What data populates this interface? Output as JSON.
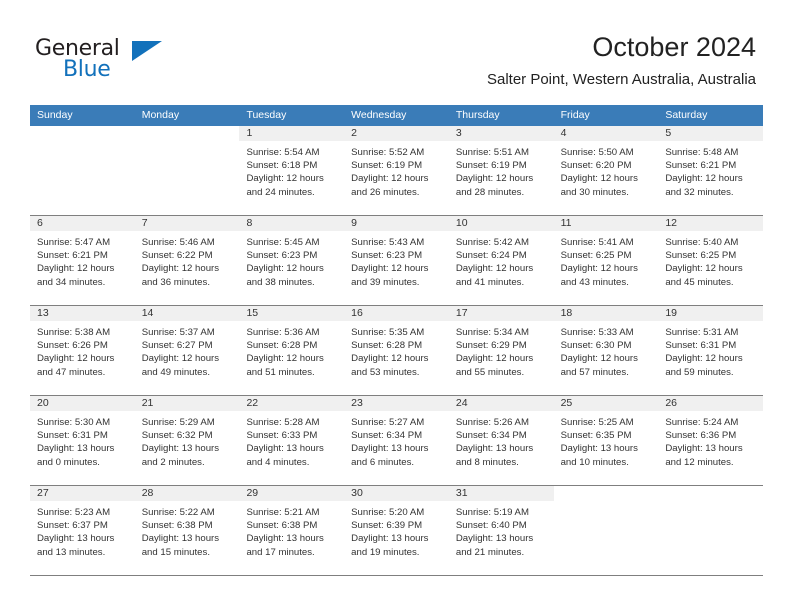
{
  "brand": {
    "name_part1": "General",
    "name_part2": "Blue",
    "accent_color": "#1271bb"
  },
  "header": {
    "title": "October 2024",
    "subtitle": "Salter Point, Western Australia, Australia"
  },
  "calendar": {
    "header_bg": "#3a7cb8",
    "daynum_band_bg": "#f0f0f0",
    "weekdays": [
      "Sunday",
      "Monday",
      "Tuesday",
      "Wednesday",
      "Thursday",
      "Friday",
      "Saturday"
    ],
    "labels": {
      "sunrise": "Sunrise:",
      "sunset": "Sunset:",
      "daylight": "Daylight:"
    },
    "weeks": [
      [
        {
          "day": "",
          "empty": true
        },
        {
          "day": "",
          "empty": true
        },
        {
          "day": "1",
          "sunrise": "Sunrise: 5:54 AM",
          "sunset": "Sunset: 6:18 PM",
          "daylight_1": "Daylight: 12 hours",
          "daylight_2": "and 24 minutes."
        },
        {
          "day": "2",
          "sunrise": "Sunrise: 5:52 AM",
          "sunset": "Sunset: 6:19 PM",
          "daylight_1": "Daylight: 12 hours",
          "daylight_2": "and 26 minutes."
        },
        {
          "day": "3",
          "sunrise": "Sunrise: 5:51 AM",
          "sunset": "Sunset: 6:19 PM",
          "daylight_1": "Daylight: 12 hours",
          "daylight_2": "and 28 minutes."
        },
        {
          "day": "4",
          "sunrise": "Sunrise: 5:50 AM",
          "sunset": "Sunset: 6:20 PM",
          "daylight_1": "Daylight: 12 hours",
          "daylight_2": "and 30 minutes."
        },
        {
          "day": "5",
          "sunrise": "Sunrise: 5:48 AM",
          "sunset": "Sunset: 6:21 PM",
          "daylight_1": "Daylight: 12 hours",
          "daylight_2": "and 32 minutes."
        }
      ],
      [
        {
          "day": "6",
          "sunrise": "Sunrise: 5:47 AM",
          "sunset": "Sunset: 6:21 PM",
          "daylight_1": "Daylight: 12 hours",
          "daylight_2": "and 34 minutes."
        },
        {
          "day": "7",
          "sunrise": "Sunrise: 5:46 AM",
          "sunset": "Sunset: 6:22 PM",
          "daylight_1": "Daylight: 12 hours",
          "daylight_2": "and 36 minutes."
        },
        {
          "day": "8",
          "sunrise": "Sunrise: 5:45 AM",
          "sunset": "Sunset: 6:23 PM",
          "daylight_1": "Daylight: 12 hours",
          "daylight_2": "and 38 minutes."
        },
        {
          "day": "9",
          "sunrise": "Sunrise: 5:43 AM",
          "sunset": "Sunset: 6:23 PM",
          "daylight_1": "Daylight: 12 hours",
          "daylight_2": "and 39 minutes."
        },
        {
          "day": "10",
          "sunrise": "Sunrise: 5:42 AM",
          "sunset": "Sunset: 6:24 PM",
          "daylight_1": "Daylight: 12 hours",
          "daylight_2": "and 41 minutes."
        },
        {
          "day": "11",
          "sunrise": "Sunrise: 5:41 AM",
          "sunset": "Sunset: 6:25 PM",
          "daylight_1": "Daylight: 12 hours",
          "daylight_2": "and 43 minutes."
        },
        {
          "day": "12",
          "sunrise": "Sunrise: 5:40 AM",
          "sunset": "Sunset: 6:25 PM",
          "daylight_1": "Daylight: 12 hours",
          "daylight_2": "and 45 minutes."
        }
      ],
      [
        {
          "day": "13",
          "sunrise": "Sunrise: 5:38 AM",
          "sunset": "Sunset: 6:26 PM",
          "daylight_1": "Daylight: 12 hours",
          "daylight_2": "and 47 minutes."
        },
        {
          "day": "14",
          "sunrise": "Sunrise: 5:37 AM",
          "sunset": "Sunset: 6:27 PM",
          "daylight_1": "Daylight: 12 hours",
          "daylight_2": "and 49 minutes."
        },
        {
          "day": "15",
          "sunrise": "Sunrise: 5:36 AM",
          "sunset": "Sunset: 6:28 PM",
          "daylight_1": "Daylight: 12 hours",
          "daylight_2": "and 51 minutes."
        },
        {
          "day": "16",
          "sunrise": "Sunrise: 5:35 AM",
          "sunset": "Sunset: 6:28 PM",
          "daylight_1": "Daylight: 12 hours",
          "daylight_2": "and 53 minutes."
        },
        {
          "day": "17",
          "sunrise": "Sunrise: 5:34 AM",
          "sunset": "Sunset: 6:29 PM",
          "daylight_1": "Daylight: 12 hours",
          "daylight_2": "and 55 minutes."
        },
        {
          "day": "18",
          "sunrise": "Sunrise: 5:33 AM",
          "sunset": "Sunset: 6:30 PM",
          "daylight_1": "Daylight: 12 hours",
          "daylight_2": "and 57 minutes."
        },
        {
          "day": "19",
          "sunrise": "Sunrise: 5:31 AM",
          "sunset": "Sunset: 6:31 PM",
          "daylight_1": "Daylight: 12 hours",
          "daylight_2": "and 59 minutes."
        }
      ],
      [
        {
          "day": "20",
          "sunrise": "Sunrise: 5:30 AM",
          "sunset": "Sunset: 6:31 PM",
          "daylight_1": "Daylight: 13 hours",
          "daylight_2": "and 0 minutes."
        },
        {
          "day": "21",
          "sunrise": "Sunrise: 5:29 AM",
          "sunset": "Sunset: 6:32 PM",
          "daylight_1": "Daylight: 13 hours",
          "daylight_2": "and 2 minutes."
        },
        {
          "day": "22",
          "sunrise": "Sunrise: 5:28 AM",
          "sunset": "Sunset: 6:33 PM",
          "daylight_1": "Daylight: 13 hours",
          "daylight_2": "and 4 minutes."
        },
        {
          "day": "23",
          "sunrise": "Sunrise: 5:27 AM",
          "sunset": "Sunset: 6:34 PM",
          "daylight_1": "Daylight: 13 hours",
          "daylight_2": "and 6 minutes."
        },
        {
          "day": "24",
          "sunrise": "Sunrise: 5:26 AM",
          "sunset": "Sunset: 6:34 PM",
          "daylight_1": "Daylight: 13 hours",
          "daylight_2": "and 8 minutes."
        },
        {
          "day": "25",
          "sunrise": "Sunrise: 5:25 AM",
          "sunset": "Sunset: 6:35 PM",
          "daylight_1": "Daylight: 13 hours",
          "daylight_2": "and 10 minutes."
        },
        {
          "day": "26",
          "sunrise": "Sunrise: 5:24 AM",
          "sunset": "Sunset: 6:36 PM",
          "daylight_1": "Daylight: 13 hours",
          "daylight_2": "and 12 minutes."
        }
      ],
      [
        {
          "day": "27",
          "sunrise": "Sunrise: 5:23 AM",
          "sunset": "Sunset: 6:37 PM",
          "daylight_1": "Daylight: 13 hours",
          "daylight_2": "and 13 minutes."
        },
        {
          "day": "28",
          "sunrise": "Sunrise: 5:22 AM",
          "sunset": "Sunset: 6:38 PM",
          "daylight_1": "Daylight: 13 hours",
          "daylight_2": "and 15 minutes."
        },
        {
          "day": "29",
          "sunrise": "Sunrise: 5:21 AM",
          "sunset": "Sunset: 6:38 PM",
          "daylight_1": "Daylight: 13 hours",
          "daylight_2": "and 17 minutes."
        },
        {
          "day": "30",
          "sunrise": "Sunrise: 5:20 AM",
          "sunset": "Sunset: 6:39 PM",
          "daylight_1": "Daylight: 13 hours",
          "daylight_2": "and 19 minutes."
        },
        {
          "day": "31",
          "sunrise": "Sunrise: 5:19 AM",
          "sunset": "Sunset: 6:40 PM",
          "daylight_1": "Daylight: 13 hours",
          "daylight_2": "and 21 minutes."
        },
        {
          "day": "",
          "empty": true
        },
        {
          "day": "",
          "empty": true
        }
      ]
    ]
  }
}
